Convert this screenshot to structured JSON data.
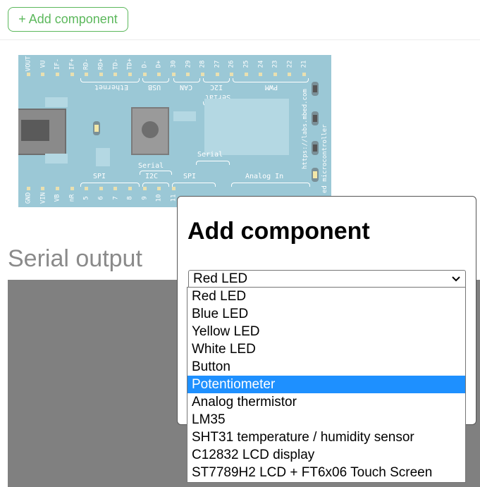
{
  "toolbar": {
    "add_label": "+ Add component"
  },
  "board": {
    "top_pins": [
      "VOUT",
      "VU",
      "IF-",
      "IF+",
      "RD-",
      "RD+",
      "TD-",
      "TD+",
      "D-",
      "D+",
      "30",
      "29",
      "28",
      "27",
      "26",
      "25",
      "24",
      "23",
      "22",
      "21"
    ],
    "bottom_pins": [
      "GND",
      "VIN",
      "VB",
      "nR",
      "5",
      "6",
      "7",
      "8",
      "9",
      "10",
      "11"
    ],
    "top_labels": [
      "Ethernet",
      "USB",
      "CAN",
      "I2C",
      "PWM"
    ],
    "top_label_serial": "Serial",
    "bottom_labels": [
      "SPI",
      "I2C",
      "SPI",
      "Analog In"
    ],
    "bottom_label_serial_left": "Serial",
    "bottom_label_serial_right": "Serial",
    "side_text_1": "https://labs.mbed.com",
    "side_text_2": "ed microcontroller"
  },
  "serial": {
    "title": "Serial output"
  },
  "modal": {
    "title": "Add component",
    "selected": "Red LED",
    "options": [
      "Red LED",
      "Blue LED",
      "Yellow LED",
      "White LED",
      "Button",
      "Potentiometer",
      "Analog thermistor",
      "LM35",
      "SHT31 temperature / humidity sensor",
      "C12832 LCD display",
      "ST7789H2 LCD + FT6x06 Touch Screen"
    ],
    "highlighted": "Potentiometer"
  },
  "colors": {
    "accent": "#5cb85c",
    "board": "#9bc8d6",
    "highlight": "#1e90ff",
    "serial_bg": "#808080"
  }
}
